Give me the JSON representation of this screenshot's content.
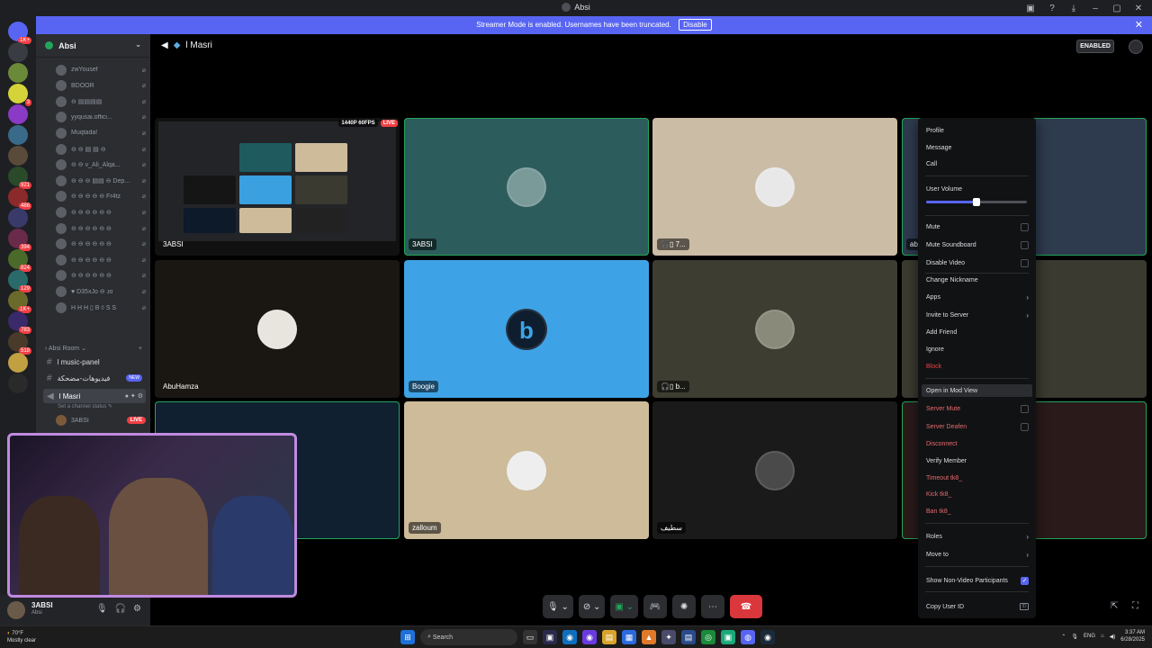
{
  "window": {
    "title": "Absi"
  },
  "banner": {
    "text": "Streamer Mode is enabled. Usernames have been truncated.",
    "disable_label": "Disable"
  },
  "server_badges": [
    "1K+",
    "",
    "",
    "3",
    "",
    "",
    "",
    "921",
    "486",
    "",
    "394",
    "824",
    "129",
    "1K+",
    "783",
    "518",
    "",
    ""
  ],
  "sidebar": {
    "guild_name": "Absi",
    "voice_members": [
      "zwYousef",
      "BDOOR",
      "⊖ ▤▤▤▤",
      "yyqusai.offici...",
      "Muqtada!",
      "⊖ ⊖ ▤ ▤ ⊖",
      "⊖ ⊖ v_Ali_Alqa...",
      "⊖ ⊖ ⊖ ▤▤ ⊖ Dep...",
      "⊖ ⊖ ⊖ ⊖ ⊖ Fr4tz",
      "⊖ ⊖ ⊖ ⊖ ⊖ ⊖",
      "⊖ ⊖ ⊖ ⊖ ⊖ ⊖",
      "⊖ ⊖ ⊖ ⊖ ⊖ ⊖",
      "⊖ ⊖ ⊖ ⊖ ⊖ ⊖",
      "⊖ ⊖ ⊖ ⊖ ⊖ ⊖",
      "♥ D35xJo ⊖ ᴊᴏ",
      "H H H ▯ B ◊ S S"
    ],
    "category": "Absi Room",
    "channels": [
      {
        "name": "l music-panel",
        "badge": ""
      },
      {
        "name": "فيديوهات-مضحكة",
        "badge": "NEW"
      },
      {
        "name": "l Masri",
        "badge": ""
      }
    ],
    "channel_status": "Set a channel status",
    "live_member": "3ABSI",
    "live_label": "LIVE"
  },
  "user_panel": {
    "name": "3ABSI",
    "status": "Absi"
  },
  "stage": {
    "channel": "l Masri",
    "enabled_label": "ENABLED",
    "stream_quality": "1440P 60FPS",
    "stream_live": "LIVE",
    "tiles": [
      "3ABSI",
      "3ABSI",
      "7...",
      "ab",
      "AbuHamza",
      "Boogie",
      "b...",
      "",
      "",
      "zalloum",
      "سطيف",
      ""
    ]
  },
  "context_menu": {
    "items_top": [
      "Profile",
      "Message",
      "Call"
    ],
    "volume_label": "User Volume",
    "volume_value": 0.5,
    "toggles": [
      "Mute",
      "Mute Soundboard",
      "Disable Video"
    ],
    "change_nickname": "Change Nickname",
    "apps": "Apps",
    "invite": "Invite to Server",
    "add_friend": "Add Friend",
    "ignore": "Ignore",
    "block": "Block",
    "mod_view": "Open in Mod View",
    "server_mute": "Server Mute",
    "server_deafen": "Server Deafen",
    "disconnect": "Disconnect",
    "verify": "Verify Member",
    "timeout": "Timeout tk8_",
    "kick": "Kick tk8_",
    "ban": "Ban tk8_",
    "roles": "Roles",
    "move_to": "Move to",
    "show_non_video": "Show Non-Video Participants",
    "copy_id": "Copy User ID",
    "id_icon": "ID"
  },
  "taskbar": {
    "weather_temp": "70°F",
    "weather_desc": "Mostly clear",
    "search": "Search",
    "lang": "ENG",
    "time": "3:37 AM",
    "date": "6/28/2025"
  },
  "colors": {
    "accent": "#5865f2",
    "danger": "#f23f43",
    "online": "#23a55a"
  }
}
